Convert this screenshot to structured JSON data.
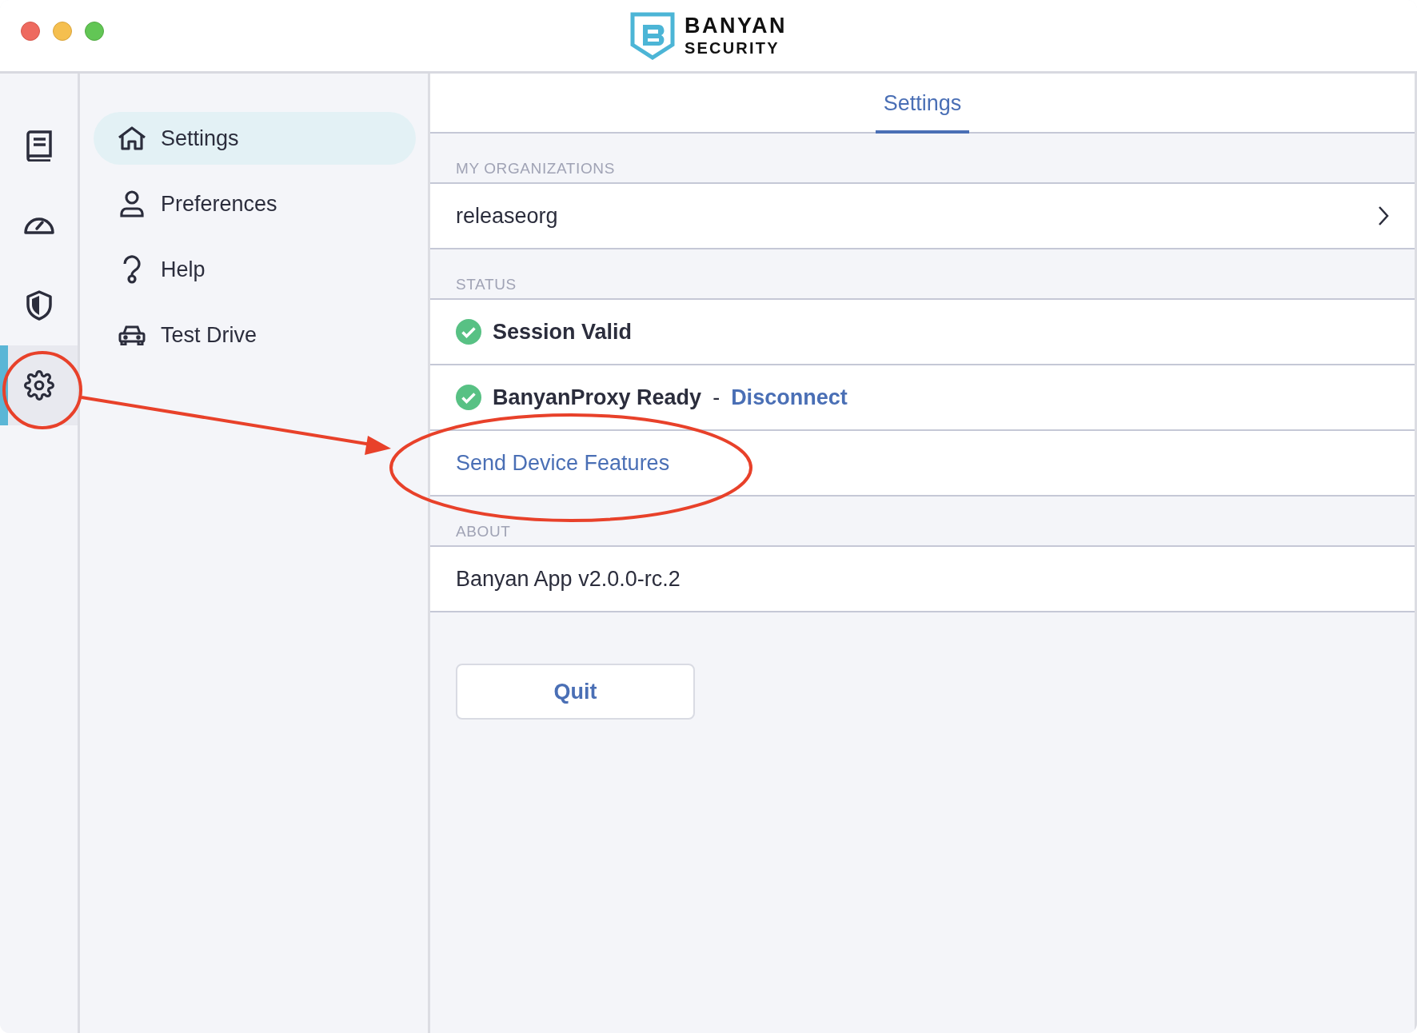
{
  "logo": {
    "name": "BANYAN",
    "tagline": "SECURITY"
  },
  "rail": [
    {
      "kind": "book",
      "selected": false
    },
    {
      "kind": "gauge",
      "selected": false
    },
    {
      "kind": "shield",
      "selected": false
    },
    {
      "kind": "gear",
      "selected": true
    }
  ],
  "nav": [
    {
      "label": "Settings",
      "kind": "home",
      "selected": true
    },
    {
      "label": "Preferences",
      "kind": "person",
      "selected": false
    },
    {
      "label": "Help",
      "kind": "help",
      "selected": false
    },
    {
      "label": "Test Drive",
      "kind": "car",
      "selected": false
    }
  ],
  "tabs": [
    {
      "label": "Settings",
      "selected": true
    }
  ],
  "sections": [
    {
      "heading": "MY ORGANIZATIONS",
      "rows": [
        {
          "kind": "link",
          "text": "releaseorg"
        }
      ]
    },
    {
      "heading": "STATUS",
      "rows": [
        {
          "kind": "status",
          "text": "Session Valid",
          "ok": true
        },
        {
          "kind": "status",
          "text": "BanyanProxy Ready",
          "ok": true,
          "separator": "-",
          "action": "Disconnect"
        },
        {
          "kind": "action",
          "text": "Send Device Features"
        }
      ]
    },
    {
      "heading": "ABOUT",
      "rows": [
        {
          "kind": "plain",
          "text": "Banyan App v2.0.0-rc.2"
        }
      ]
    }
  ],
  "quit_button": "Quit",
  "annotations": [
    {
      "kind": "circle"
    },
    {
      "kind": "arrow"
    },
    {
      "kind": "ellipse"
    }
  ]
}
